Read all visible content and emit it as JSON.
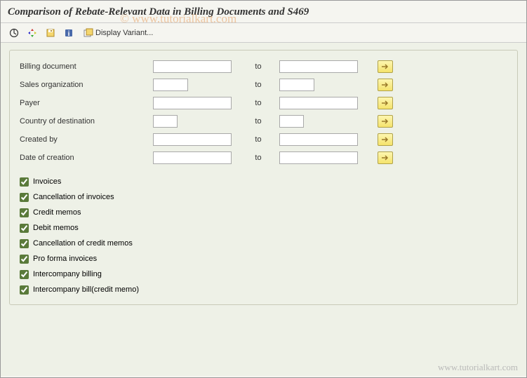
{
  "header": {
    "title": "Comparison of Rebate-Relevant Data in Billing Documents and S469"
  },
  "toolbar": {
    "execute_icon": "execute-icon",
    "refresh_icon": "refresh-icon",
    "save_icon": "save-icon",
    "info_icon": "info-icon",
    "variant_icon": "variant-icon",
    "variant_label": "Display Variant..."
  },
  "selection": {
    "to_label": "to",
    "rows": [
      {
        "label": "Billing document",
        "from": "",
        "to": "",
        "from_width": "med",
        "to_width": "med"
      },
      {
        "label": "Sales organization",
        "from": "",
        "to": "",
        "from_width": "short",
        "to_width": "short"
      },
      {
        "label": "Payer",
        "from": "",
        "to": "",
        "from_width": "med",
        "to_width": "med"
      },
      {
        "label": "Country of destination",
        "from": "",
        "to": "",
        "from_width": "shorter",
        "to_width": "shorter"
      },
      {
        "label": "Created by",
        "from": "",
        "to": "",
        "from_width": "med",
        "to_width": "med"
      },
      {
        "label": "Date of creation",
        "from": "",
        "to": "",
        "from_width": "med",
        "to_width": "med"
      }
    ]
  },
  "checkboxes": [
    {
      "label": "Invoices",
      "checked": true
    },
    {
      "label": "Cancellation of invoices",
      "checked": true
    },
    {
      "label": "Credit memos",
      "checked": true
    },
    {
      "label": "Debit memos",
      "checked": true
    },
    {
      "label": "Cancellation of credit memos",
      "checked": true
    },
    {
      "label": "Pro forma invoices",
      "checked": true
    },
    {
      "label": "Intercompany billing",
      "checked": true
    },
    {
      "label": "Intercompany bill(credit memo)",
      "checked": true
    }
  ],
  "watermark": {
    "top": "© www.tutorialkart.com",
    "bottom": "www.tutorialkart.com"
  }
}
